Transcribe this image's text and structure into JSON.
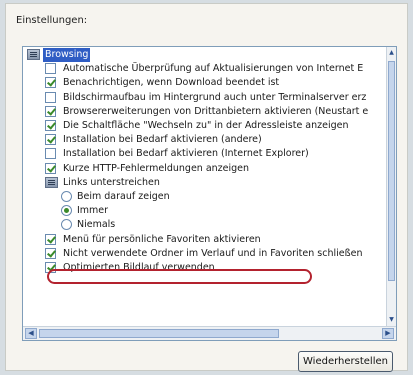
{
  "settings": {
    "group_label": "Einstellungen:",
    "category": {
      "label": "Browsing",
      "icon": "folder-icon"
    },
    "items": [
      {
        "label": "Automatische Überprüfung auf Aktualisierungen von Internet E",
        "control": "checkbox",
        "checked": false
      },
      {
        "label": "Benachrichtigen, wenn Download beendet ist",
        "control": "checkbox",
        "checked": true
      },
      {
        "label": "Bildschirmaufbau im Hintergrund auch unter Terminalserver erz",
        "control": "checkbox",
        "checked": false
      },
      {
        "label": "Browsererweiterungen von Drittanbietern aktivieren (Neustart e",
        "control": "checkbox",
        "checked": true
      },
      {
        "label": "Die Schaltfläche \"Wechseln zu\" in der Adressleiste anzeigen",
        "control": "checkbox",
        "checked": true
      },
      {
        "label": "Installation bei Bedarf aktivieren (andere)",
        "control": "checkbox",
        "checked": true
      },
      {
        "label": "Installation bei Bedarf aktivieren (Internet Explorer)",
        "control": "checkbox",
        "checked": false
      },
      {
        "label": "Kurze HTTP-Fehlermeldungen anzeigen",
        "control": "checkbox",
        "checked": true
      }
    ],
    "subgroup": {
      "label": "Links unterstreichen",
      "options": [
        {
          "label": "Beim darauf zeigen",
          "selected": false
        },
        {
          "label": "Immer",
          "selected": true
        },
        {
          "label": "Niemals",
          "selected": false
        }
      ]
    },
    "items_after": [
      {
        "label": "Menü für persönliche Favoriten aktivieren",
        "control": "checkbox",
        "checked": true,
        "annotated": true
      },
      {
        "label": "Nicht verwendete Ordner im Verlauf und in Favoriten schließen",
        "control": "checkbox",
        "checked": true
      },
      {
        "label": "Optimierten Bildlauf verwenden",
        "control": "checkbox",
        "checked": true
      }
    ],
    "reset_button_label": "Wiederherstellen"
  }
}
